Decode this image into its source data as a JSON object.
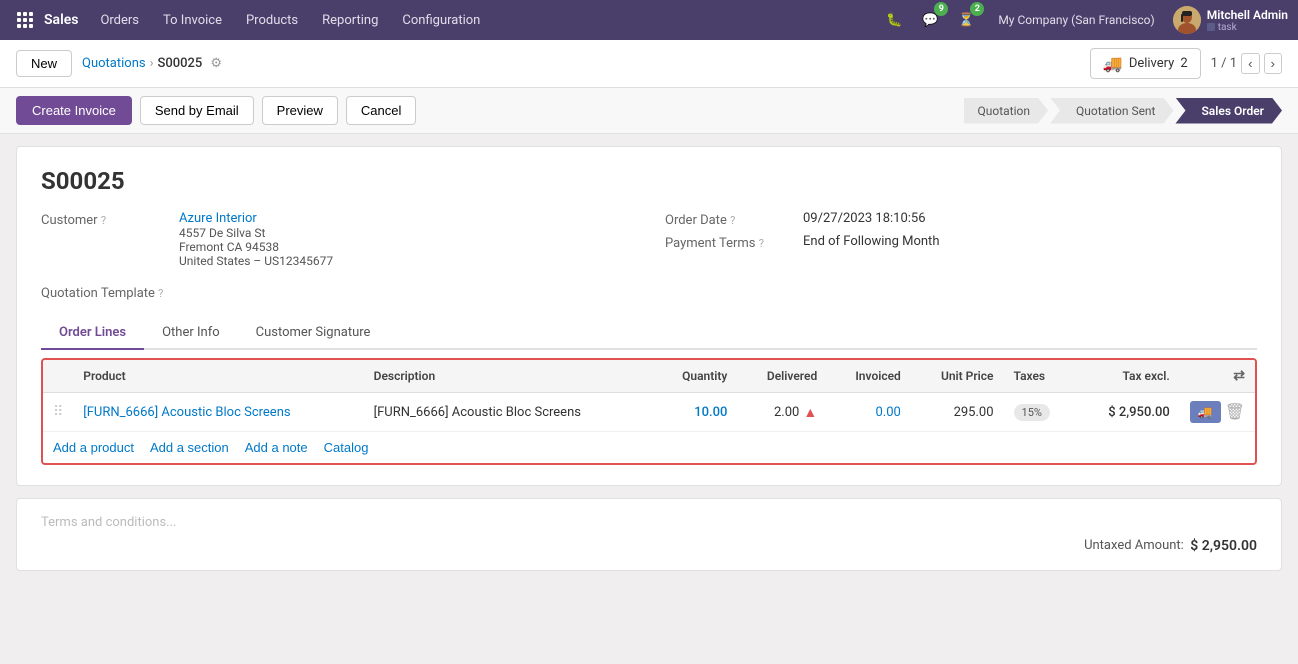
{
  "topnav": {
    "brand": "Sales",
    "items": [
      "Orders",
      "To Invoice",
      "Products",
      "Reporting",
      "Configuration"
    ],
    "notifications_count": "9",
    "messages_count": "2",
    "company": "My Company (San Francisco)",
    "user_name": "Mitchell Admin",
    "user_task": "task"
  },
  "subheader": {
    "new_label": "New",
    "breadcrumb_parent": "Quotations",
    "breadcrumb_id": "S00025",
    "delivery_label": "Delivery",
    "delivery_count": "2",
    "pager": "1 / 1"
  },
  "action_bar": {
    "create_invoice": "Create Invoice",
    "send_by_email": "Send by Email",
    "preview": "Preview",
    "cancel": "Cancel"
  },
  "status_pipeline": {
    "steps": [
      "Quotation",
      "Quotation Sent",
      "Sales Order"
    ],
    "active": "Sales Order"
  },
  "document": {
    "title": "S00025",
    "customer_label": "Customer",
    "customer_name": "Azure Interior",
    "customer_address1": "4557 De Silva St",
    "customer_address2": "Fremont CA 94538",
    "customer_address3": "United States – US12345677",
    "order_date_label": "Order Date",
    "order_date": "09/27/2023 18:10:56",
    "payment_terms_label": "Payment Terms",
    "payment_terms": "End of Following Month",
    "quotation_template_label": "Quotation Template"
  },
  "tabs": {
    "items": [
      "Order Lines",
      "Other Info",
      "Customer Signature"
    ],
    "active": "Order Lines"
  },
  "order_table": {
    "columns": [
      "Product",
      "Description",
      "Quantity",
      "Delivered",
      "Invoiced",
      "Unit Price",
      "Taxes",
      "Tax excl.",
      ""
    ],
    "rows": [
      {
        "product": "[FURN_6666] Acoustic Bloc Screens",
        "description": "[FURN_6666] Acoustic Bloc Screens",
        "quantity": "10.00",
        "delivered": "2.00",
        "invoiced": "0.00",
        "unit_price": "295.00",
        "taxes": "15%",
        "tax_excl": "$ 2,950.00"
      }
    ],
    "add_product": "Add a product",
    "add_section": "Add a section",
    "add_note": "Add a note",
    "catalog": "Catalog"
  },
  "footer": {
    "terms_placeholder": "Terms and conditions...",
    "untaxed_amount_label": "Untaxed Amount:",
    "untaxed_amount": "$ 2,950.00"
  }
}
